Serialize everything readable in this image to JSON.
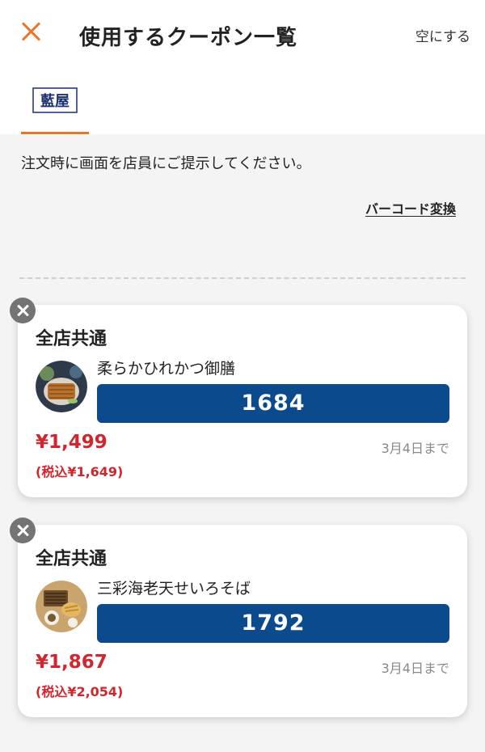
{
  "header": {
    "title": "使用するクーポン一覧",
    "clear_label": "空にする"
  },
  "tabs": [
    {
      "logo_text": "藍屋",
      "active": true
    }
  ],
  "instruction": "注文時に画面を店員にご提示してください。",
  "barcode_link": "バーコード変換",
  "coupons": [
    {
      "scope": "全店共通",
      "name": "柔らかひれかつ御膳",
      "code": "1684",
      "price": "¥1,499",
      "tax_price": "(税込¥1,649)",
      "expiry": "3月4日まで"
    },
    {
      "scope": "全店共通",
      "name": "三彩海老天せいろそば",
      "code": "1792",
      "price": "¥1,867",
      "tax_price": "(税込¥2,054)",
      "expiry": "3月4日まで"
    }
  ],
  "colors": {
    "accent": "#e8752a",
    "code_bg": "#0b4a8c",
    "price": "#d0262e"
  }
}
